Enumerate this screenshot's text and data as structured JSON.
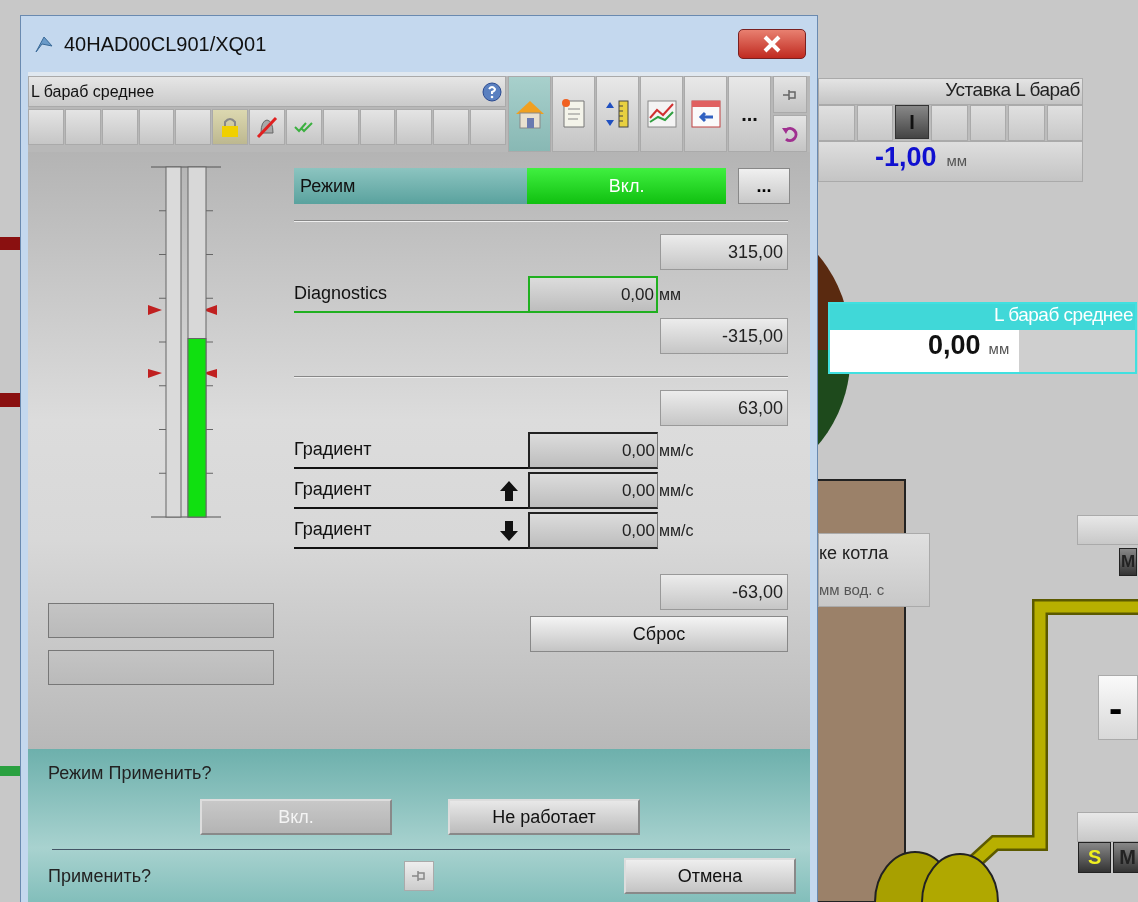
{
  "background": {
    "setpoint": {
      "title": "Уставка L бараб",
      "switch": "I",
      "value": "-1,00",
      "unit": "мм"
    },
    "level_display": {
      "title": "L бараб среднее",
      "value": "0,00",
      "unit": "мм"
    },
    "pressure": {
      "title": "ке котла",
      "unit": "мм вод. с"
    },
    "display": {
      "value": "-"
    },
    "badges_top": [
      "M"
    ],
    "badges_bottom": [
      "S",
      "M"
    ]
  },
  "window": {
    "title": "40HAD00CL901/XQ01"
  },
  "header": {
    "tag": "L бараб среднее",
    "status_buttons": [
      {
        "kind": "blank"
      },
      {
        "kind": "blank"
      },
      {
        "kind": "blank"
      },
      {
        "kind": "blank"
      },
      {
        "kind": "blank"
      },
      {
        "kind": "lock"
      },
      {
        "kind": "alarm_off"
      },
      {
        "kind": "check"
      },
      {
        "kind": "blank"
      },
      {
        "kind": "blank"
      },
      {
        "kind": "blank"
      },
      {
        "kind": "blank"
      },
      {
        "kind": "blank"
      }
    ],
    "views": [
      {
        "kind": "home",
        "selected": true
      },
      {
        "kind": "report",
        "selected": false
      },
      {
        "kind": "ruler",
        "selected": false
      },
      {
        "kind": "trend",
        "selected": false
      },
      {
        "kind": "faceplate",
        "selected": false
      },
      {
        "kind": "more",
        "label": "...",
        "selected": false
      }
    ]
  },
  "gauge": {
    "level": 0.51
  },
  "mode": {
    "label": "Режим",
    "value": "Вкл.",
    "on": true,
    "button": "..."
  },
  "diagnostics": {
    "high": "315,00",
    "label": "Diagnostics",
    "value": "0,00",
    "unit": "мм",
    "low": "-315,00"
  },
  "gradient": {
    "high": "63,00",
    "rows": [
      {
        "kind": "plain",
        "label": "Градиент",
        "value": "0,00",
        "unit": "мм/с"
      },
      {
        "kind": "up",
        "label": "Градиент",
        "value": "0,00",
        "unit": "мм/с"
      },
      {
        "kind": "down",
        "label": "Градиент",
        "value": "0,00",
        "unit": "мм/с"
      }
    ],
    "low": "-63,00",
    "reset": "Сброс"
  },
  "apply": {
    "prompt": "Режим Применить?",
    "buttons": [
      {
        "label": "Вкл.",
        "disabled": true
      },
      {
        "label": "Не работает",
        "disabled": false
      }
    ],
    "confirm": "Применить?",
    "cancel": "Отмена"
  }
}
